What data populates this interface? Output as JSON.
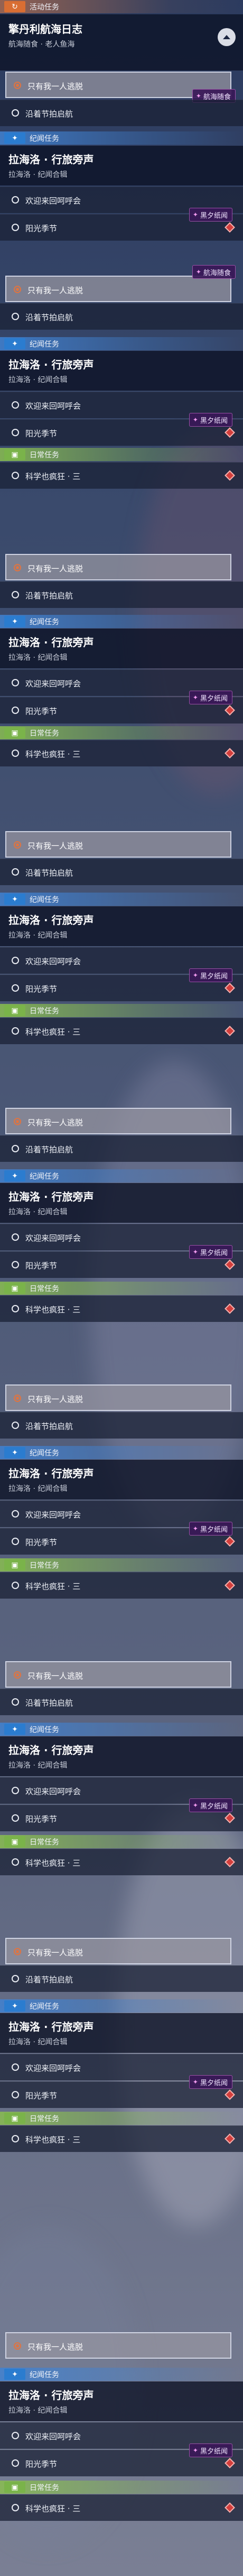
{
  "event_category": {
    "label": "活动任务",
    "badge_glyph": "↻"
  },
  "story_category": {
    "label": "纪闻任务",
    "badge_glyph": "✦"
  },
  "daily_category": {
    "label": "日常任务",
    "badge_glyph": "▣"
  },
  "event_quest": {
    "title": "擎丹利航海日志",
    "subtitle": "航海随食 · 老人鱼海",
    "hint_tag": "航海随食",
    "current_task": "只有我一人逃脱",
    "next_task": "沿着节拍启航"
  },
  "story_quest": {
    "title": "拉海洛 · 行旅旁声",
    "subtitle": "拉海洛 · 纪闻合辑",
    "tasks": [
      "欢迎来回呵呼会",
      "阳光季节"
    ],
    "hint_tag": "黑夕纸闻"
  },
  "daily_quest": {
    "task": "科学也疯狂 · 三"
  },
  "colors": {
    "event_orange": "#d96e33",
    "story_blue": "#2b7ccf",
    "daily_green": "#7ab34a",
    "marker_red": "#d33e3c"
  }
}
